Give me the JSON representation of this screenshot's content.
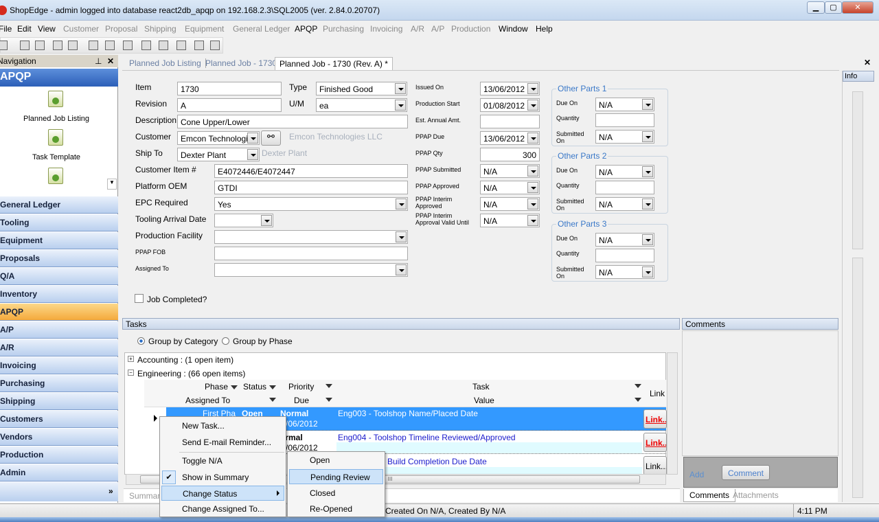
{
  "window": {
    "title": "ShopEdge - admin logged into database react2db_apqp on 192.168.2.3\\SQL2005 (ver. 2.84.0.20707)",
    "min": "▁",
    "max": "▢",
    "close": "✕"
  },
  "menu": [
    {
      "label": "File",
      "enabled": true
    },
    {
      "label": "Edit",
      "enabled": true
    },
    {
      "label": "View",
      "enabled": true
    },
    {
      "label": "Customer",
      "enabled": false
    },
    {
      "label": "Proposal",
      "enabled": false
    },
    {
      "label": "Shipping",
      "enabled": false
    },
    {
      "label": "Equipment",
      "enabled": false
    },
    {
      "label": "General Ledger",
      "enabled": false
    },
    {
      "label": "APQP",
      "enabled": true
    },
    {
      "label": "Purchasing",
      "enabled": false
    },
    {
      "label": "Invoicing",
      "enabled": false
    },
    {
      "label": "A/R",
      "enabled": false
    },
    {
      "label": "A/P",
      "enabled": false
    },
    {
      "label": "Production",
      "enabled": false
    },
    {
      "label": "Window",
      "enabled": true
    },
    {
      "label": "Help",
      "enabled": true
    }
  ],
  "toolbar": [
    "new-icon",
    "save-icon",
    "save-all-icon",
    "print-icon",
    "print-preview-icon",
    "cut-icon",
    "copy-icon",
    "paste-icon",
    "add-row-icon",
    "delete-row-icon",
    "stamp-icon",
    "refresh-icon",
    "edit-icon"
  ],
  "navigation": {
    "title": "Navigation",
    "pin": "⊥",
    "close": "✕",
    "section": "APQP",
    "shortcuts": [
      "Planned Job Listing",
      "Task Template"
    ],
    "items": [
      "General Ledger",
      "Tooling",
      "Equipment",
      "Proposals",
      "Q/A",
      "Inventory",
      "APQP",
      "A/P",
      "A/R",
      "Invoicing",
      "Purchasing",
      "Shipping",
      "Customers",
      "Vendors",
      "Production",
      "Admin"
    ],
    "active": "APQP",
    "more": "»"
  },
  "tabs": [
    "Planned Job Listing",
    "Planned Job - 1730",
    "Planned Job - 1730 (Rev. A) *"
  ],
  "form": {
    "item": {
      "label": "Item",
      "value": "1730"
    },
    "type": {
      "label": "Type",
      "value": "Finished Good"
    },
    "revision": {
      "label": "Revision",
      "value": "A"
    },
    "um": {
      "label": "U/M",
      "value": "ea"
    },
    "description": {
      "label": "Description",
      "value": "Cone Upper/Lower"
    },
    "customer": {
      "label": "Customer",
      "value": "Emcon Technologi",
      "name": "Emcon Technologies LLC"
    },
    "ship_to": {
      "label": "Ship To",
      "value": "Dexter Plant",
      "name": "Dexter Plant"
    },
    "customer_item": {
      "label": "Customer Item #",
      "value": "E4072446/E4072447"
    },
    "platform_oem": {
      "label": "Platform OEM",
      "value": "GTDI"
    },
    "epc_required": {
      "label": "EPC Required",
      "value": "Yes"
    },
    "tooling_arrival": {
      "label": "Tooling Arrival Date",
      "value": ""
    },
    "production_facility": {
      "label": "Production Facility",
      "value": ""
    },
    "ppap_fob": {
      "label": "PPAP FOB",
      "value": ""
    },
    "assigned_to": {
      "label": "Assigned To",
      "value": ""
    },
    "job_completed": {
      "label": "Job Completed?",
      "checked": false
    },
    "issued_on": {
      "label": "Issued On",
      "value": "13/06/2012"
    },
    "production_start": {
      "label": "Production Start",
      "value": "01/08/2012"
    },
    "est_annual": {
      "label": "Est. Annual Amt.",
      "value": ""
    },
    "ppap_due": {
      "label": "PPAP Due",
      "value": "13/06/2012"
    },
    "ppap_qty": {
      "label": "PPAP Qty",
      "value": "300"
    },
    "ppap_submitted": {
      "label": "PPAP Submitted",
      "value": "N/A"
    },
    "ppap_approved": {
      "label": "PPAP Approved",
      "value": "N/A"
    },
    "ppap_interim": {
      "label": "PPAP Interim Approved",
      "value": "N/A"
    },
    "ppap_interim_valid": {
      "label": "PPAP Interim Approval Valid Until",
      "value": "N/A"
    },
    "other_parts": [
      {
        "title": "Other Parts 1",
        "due_on_label": "Due On",
        "due_on": "N/A",
        "qty_label": "Quantity",
        "qty": "",
        "submitted_label": "Submitted On",
        "submitted": "N/A"
      },
      {
        "title": "Other Parts 2",
        "due_on_label": "Due On",
        "due_on": "N/A",
        "qty_label": "Quantity",
        "qty": "",
        "submitted_label": "Submitted On",
        "submitted": "N/A"
      },
      {
        "title": "Other Parts 3",
        "due_on_label": "Due On",
        "due_on": "N/A",
        "qty_label": "Quantity",
        "qty": "",
        "submitted_label": "Submitted On",
        "submitted": "N/A"
      }
    ]
  },
  "info": {
    "title": "Info"
  },
  "tasks": {
    "title": "Tasks",
    "group_by": [
      "Group by Category",
      "Group by Phase"
    ],
    "group_selected": "Group by Category",
    "groups": [
      {
        "label": "Accounting : (1 open item)",
        "expanded": false
      },
      {
        "label": "Engineering : (66 open items)",
        "expanded": true
      }
    ],
    "columns": {
      "phase": "Phase",
      "status": "Status",
      "priority": "Priority",
      "task": "Task",
      "link": "Link",
      "assigned": "Assigned To",
      "due": "Due",
      "value": "Value"
    },
    "rows": [
      {
        "phase": "First Pha",
        "status": "Open",
        "priority": "Normal",
        "due": "/06/2012",
        "task": "Eng003 - Toolshop Name/Placed Date",
        "link": "Link..."
      },
      {
        "priority": "ormal",
        "due": "/06/2012",
        "task": "Eng004 - Toolshop Timeline Reviewed/Approved",
        "link": "Link..."
      },
      {
        "task": "Build Completion Due Date",
        "link": "Link..."
      }
    ],
    "summary_tab": "Summary",
    "scroll_mark": "III"
  },
  "context_menu": {
    "items": [
      "New Task...",
      "Send E-mail Reminder...",
      "Toggle N/A",
      "Show in Summary",
      "Change Status",
      "Change Assigned To..."
    ],
    "checked": "Show in Summary",
    "highlighted": "Change Status",
    "submenu": [
      "Open",
      "Pending Review",
      "Closed",
      "Re-Opened"
    ],
    "sub_highlighted": "Pending Review"
  },
  "comments": {
    "title": "Comments",
    "add": "Add",
    "comment_button": "Comment",
    "tabs": [
      "Comments",
      "Attachments"
    ]
  },
  "status": {
    "text": "Created On N/A, Created By N/A",
    "time": "4:11 PM"
  }
}
